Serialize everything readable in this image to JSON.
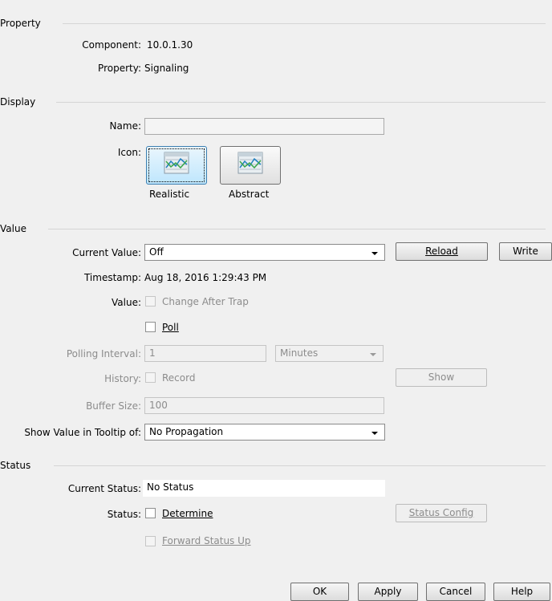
{
  "property_section": {
    "title": "Property",
    "component_label": "Component:",
    "component_value": "10.0.1.30",
    "property_label": "Property:",
    "property_value": "Signaling"
  },
  "display_section": {
    "title": "Display",
    "name_label": "Name:",
    "name_value": "",
    "icon_label": "Icon:",
    "icons": [
      {
        "label": "Realistic",
        "selected": true
      },
      {
        "label": "Abstract",
        "selected": false
      }
    ]
  },
  "value_section": {
    "title": "Value",
    "current_value_label": "Current Value:",
    "current_value": "Off",
    "reload_label": "Reload",
    "write_label": "Write",
    "timestamp_label": "Timestamp:",
    "timestamp_value": "Aug 18, 2016 1:29:43 PM",
    "value_label": "Value:",
    "change_after_trap_label": "Change After Trap",
    "poll_label": "Poll",
    "polling_interval_label": "Polling Interval:",
    "polling_interval_value": "1",
    "polling_unit": "Minutes",
    "history_label": "History:",
    "record_label": "Record",
    "show_label": "Show",
    "buffer_size_label": "Buffer Size:",
    "buffer_size_value": "100",
    "tooltip_label": "Show Value in Tooltip of:",
    "tooltip_value": "No Propagation"
  },
  "status_section": {
    "title": "Status",
    "current_status_label": "Current Status:",
    "current_status_value": "No Status",
    "status_label": "Status:",
    "determine_label": "Determine",
    "status_config_label": "Status Config",
    "forward_status_label": "Forward Status Up"
  },
  "footer": {
    "ok_label": "OK",
    "apply_label": "Apply",
    "cancel_label": "Cancel",
    "help_label": "Help"
  },
  "colors": {
    "background": "#f0f0f0",
    "selected_icon_bg": "#bee6fd",
    "disabled_text": "#8c8c8c"
  }
}
